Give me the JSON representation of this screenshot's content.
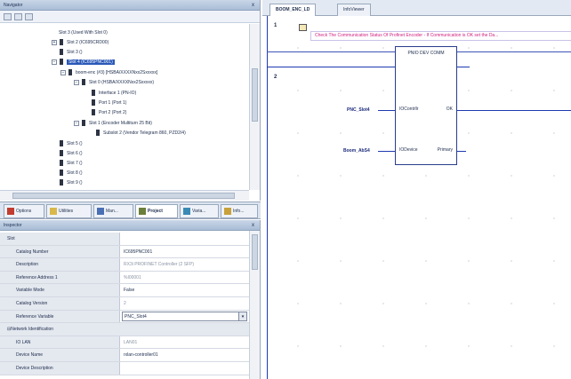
{
  "navigator": {
    "title": "Navigator",
    "close_glyph": "x",
    "tree": [
      {
        "label": "Slot 3 (Used With Slot 0)"
      },
      {
        "label": "Slot 2 (IC695CRD00)"
      },
      {
        "label": "Slot 3 ()"
      },
      {
        "label": "Slot 4 (IC695PNC001)",
        "selected": true
      },
      {
        "label": "boom-enc (#3) [HSBA/XXXXNxx2Sxxxxx]"
      },
      {
        "label": "Slot 0 (HSBA/XXXXNxx2Sxxxxx)"
      },
      {
        "label": "Interface 1 (PN-IO)"
      },
      {
        "label": "Port 1 (Port 1)"
      },
      {
        "label": "Port 2 (Port 2)"
      },
      {
        "label": "Slot 1 (Encoder Multiturn 25 Bit)"
      },
      {
        "label": "Subslot 2 (Vendor Telegram 860, PZD2/4)"
      },
      {
        "label": "Slot 5 ()"
      },
      {
        "label": "Slot 6 ()"
      },
      {
        "label": "Slot 7 ()"
      },
      {
        "label": "Slot 8 ()"
      },
      {
        "label": "Slot 9 ()"
      }
    ],
    "tabs": [
      "Options",
      "Utilities",
      "Man...",
      "Project",
      "Varia...",
      "Info..."
    ],
    "active_tab": "Project"
  },
  "inspector": {
    "title": "Inspector",
    "close_glyph": "x",
    "rows": [
      {
        "name": "Slot",
        "value": "",
        "type": "header"
      },
      {
        "name": "Catalog Number",
        "value": "IC695PNC001"
      },
      {
        "name": "Description",
        "value": "RX3i PROFINET Controller (2 SFP)",
        "grey": true
      },
      {
        "name": "Reference Address 1",
        "value": "%I00001",
        "grey": true
      },
      {
        "name": "Variable Mode",
        "value": "False"
      },
      {
        "name": "Catalog Version",
        "value": "2",
        "grey": true
      },
      {
        "name": "Reference Variable",
        "value": "PNC_Slot4",
        "type": "dropdown"
      },
      {
        "name": "Network Identification",
        "value": "",
        "type": "group"
      },
      {
        "name": "IO LAN",
        "value": "LAN01",
        "grey": true
      },
      {
        "name": "Device Name",
        "value": "rxlan-controller01"
      },
      {
        "name": "Device Description",
        "value": ""
      }
    ]
  },
  "editor": {
    "tabs": [
      "BOOM_ENC_LD",
      "InfoViewer"
    ],
    "active_tab": "BOOM_ENC_LD",
    "rungs": [
      {
        "number": "1",
        "comment": "Check The Communication Status Of Profinet Encoder - If Communication is OK set the Da..."
      },
      {
        "number": "2"
      }
    ],
    "function_block": {
      "title": "PNIO DEV COMM",
      "inputs": [
        "IOContrllr",
        "IODevice"
      ],
      "outputs": [
        "OK",
        "Primary"
      ],
      "input_vars": [
        "PNC_Slot4",
        "Boom_AbS4"
      ]
    }
  }
}
